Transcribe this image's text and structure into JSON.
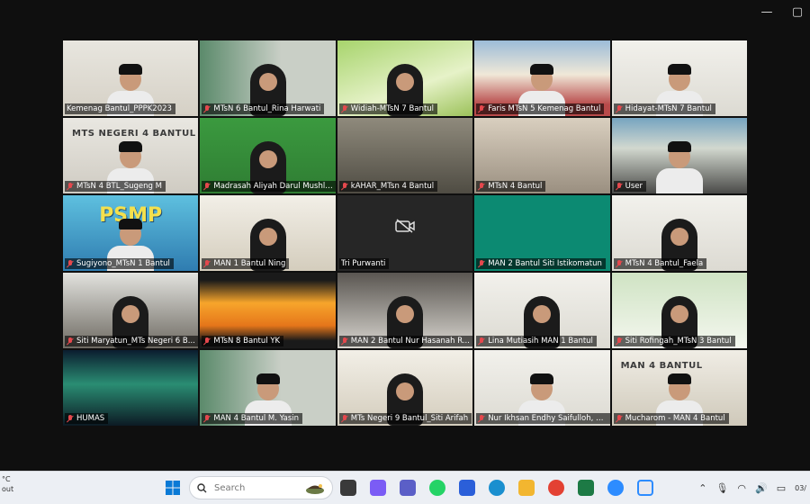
{
  "window": {
    "minimize_glyph": "—",
    "maximize_glyph": "▢"
  },
  "participants": [
    {
      "name": "Kemenag Bantul_PPPK2023",
      "muted": false,
      "active": true,
      "scene": "office-pattern",
      "person": "cap"
    },
    {
      "name": "MTsN 6 Bantul_Rina Harwati",
      "muted": true,
      "scene": "green-room",
      "person": "veil"
    },
    {
      "name": "Widiah-MTsN 7 Bantul",
      "muted": true,
      "scene": "grass",
      "person": "veil"
    },
    {
      "name": "Faris MTsN 5 Kemenag Bantul",
      "muted": true,
      "scene": "building",
      "person": "cap"
    },
    {
      "name": "Hidayat-MTsN 7 Bantul",
      "muted": true,
      "scene": "white-room",
      "person": "cap"
    },
    {
      "name": "MTsN 4 BTL_Sugeng M",
      "muted": true,
      "scene": "school-sign",
      "person": "cap",
      "sign": "MTS NEGERI 4 BANTUL"
    },
    {
      "name": "Madrasah Aliyah Darul Mushli...",
      "muted": true,
      "scene": "green-wall",
      "person": "veil"
    },
    {
      "name": "kAHAR_MTsn 4 Bantul",
      "muted": true,
      "scene": "classroom",
      "person": "none"
    },
    {
      "name": "MTsN 4 Bantul",
      "muted": true,
      "scene": "blurry-room",
      "person": "none"
    },
    {
      "name": "User",
      "muted": true,
      "scene": "shelf",
      "person": "cap"
    },
    {
      "name": "Sugiyono_MTsN 1 Bantul",
      "muted": true,
      "scene": "banner",
      "person": "cap",
      "banner": "PSMP"
    },
    {
      "name": "MAN 1 Bantul Ning",
      "muted": true,
      "scene": "light-room",
      "person": "veil"
    },
    {
      "name": "Tri Purwanti",
      "muted": false,
      "scene": "camera-off",
      "person": "none"
    },
    {
      "name": "MAN 2 Bantul Siti Istikomatun",
      "muted": true,
      "scene": "teal",
      "person": "none"
    },
    {
      "name": "MTsN 4 Bantul_Faela",
      "muted": true,
      "scene": "white-room",
      "person": "veil"
    },
    {
      "name": "Siti Maryatun_MTs Negeri 6 B...",
      "muted": true,
      "scene": "dark-room",
      "person": "veil"
    },
    {
      "name": "MTsN 8 Bantul YK",
      "muted": true,
      "scene": "sunset",
      "person": "none"
    },
    {
      "name": "MAN 2 Bantul Nur Hasanah R...",
      "muted": true,
      "scene": "dim-room",
      "person": "veil"
    },
    {
      "name": "Lina Mutiasih MAN 1 Bantul",
      "muted": true,
      "scene": "white-room",
      "person": "veil"
    },
    {
      "name": "Siti Rofingah_MTsN 3 Bantul",
      "muted": true,
      "scene": "light-green",
      "person": "veil"
    },
    {
      "name": "HUMAS",
      "muted": true,
      "scene": "aurora",
      "person": "none"
    },
    {
      "name": "MAN 4 Bantul M. Yasin",
      "muted": true,
      "scene": "green-room",
      "person": "cap"
    },
    {
      "name": "MTs Negeri 9 Bantul_Siti Arifah",
      "muted": true,
      "scene": "light-room",
      "person": "veil"
    },
    {
      "name": "Nur Ikhsan Endhy Saifulloh, SIP...",
      "muted": true,
      "scene": "white-room",
      "person": "cap"
    },
    {
      "name": "Mucharom - MAN 4 Bantul",
      "muted": true,
      "scene": "office-sign",
      "person": "cap",
      "sign": "MAN 4 BANTUL"
    }
  ],
  "taskbar": {
    "left_lines": [
      "°C",
      "out"
    ],
    "search_placeholder": "Search",
    "apps": [
      "file-explorer-icon",
      "copilot-icon",
      "teams-icon",
      "whatsapp-icon",
      "store-icon",
      "edge-icon",
      "folder-icon",
      "chrome-icon",
      "excel-icon",
      "zoom-icon",
      "settings-icon"
    ],
    "clock": "03/"
  },
  "colors": {
    "active_border": "#2ec36b",
    "muted": "#e5484d",
    "taskbar_bg": "#eceff4"
  }
}
